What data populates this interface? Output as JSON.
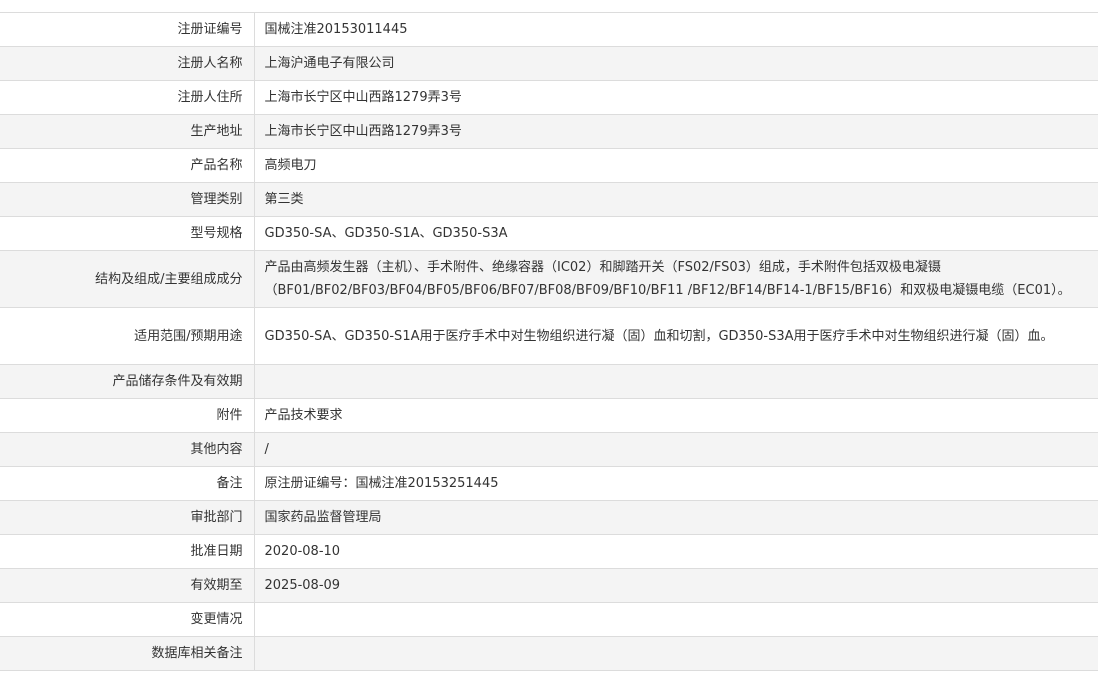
{
  "rows": [
    {
      "label": "注册证编号",
      "value": "国械注准20153011445"
    },
    {
      "label": "注册人名称",
      "value": "上海沪通电子有限公司"
    },
    {
      "label": "注册人住所",
      "value": "上海市长宁区中山西路1279弄3号"
    },
    {
      "label": "生产地址",
      "value": "上海市长宁区中山西路1279弄3号"
    },
    {
      "label": "产品名称",
      "value": "高频电刀"
    },
    {
      "label": "管理类别",
      "value": "第三类"
    },
    {
      "label": "型号规格",
      "value": "GD350-SA、GD350-S1A、GD350-S3A"
    },
    {
      "label": "结构及组成/主要组成成分",
      "value": "产品由高频发生器（主机）、手术附件、绝缘容器（IC02）和脚踏开关（FS02/FS03）组成，手术附件包括双极电凝镊（BF01/BF02/BF03/BF04/BF05/BF06/BF07/BF08/BF09/BF10/BF11 /BF12/BF14/BF14-1/BF15/BF16）和双极电凝镊电缆（EC01）。"
    },
    {
      "label": "适用范围/预期用途",
      "value": "GD350-SA、GD350-S1A用于医疗手术中对生物组织进行凝（固）血和切割，GD350-S3A用于医疗手术中对生物组织进行凝（固）血。"
    },
    {
      "label": "产品储存条件及有效期",
      "value": ""
    },
    {
      "label": "附件",
      "value": "产品技术要求"
    },
    {
      "label": "其他内容",
      "value": "/"
    },
    {
      "label": "备注",
      "value": "原注册证编号：国械注准20153251445"
    },
    {
      "label": "审批部门",
      "value": "国家药品监督管理局"
    },
    {
      "label": "批准日期",
      "value": "2020-08-10"
    },
    {
      "label": "有效期至",
      "value": "2025-08-09"
    },
    {
      "label": "变更情况",
      "value": ""
    },
    {
      "label": "数据库相关备注",
      "value": ""
    }
  ]
}
